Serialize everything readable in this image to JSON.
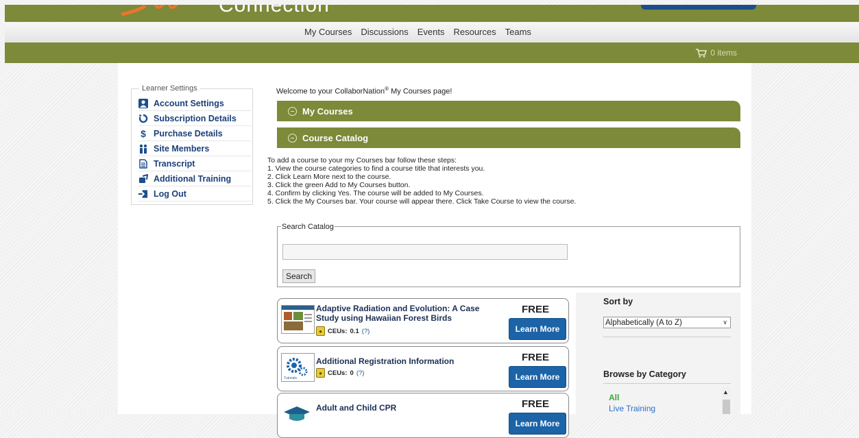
{
  "header": {
    "logo_text": "Connection"
  },
  "nav": {
    "items": [
      "My Courses",
      "Discussions",
      "Events",
      "Resources",
      "Teams"
    ]
  },
  "cart": {
    "label": "0 items"
  },
  "settings": {
    "legend": "Learner Settings",
    "items": [
      {
        "label": "Account Settings",
        "icon": "user-icon"
      },
      {
        "label": "Subscription Details",
        "icon": "refresh-icon"
      },
      {
        "label": "Purchase Details",
        "icon": "dollar-icon"
      },
      {
        "label": "Site Members",
        "icon": "members-icon"
      },
      {
        "label": "Transcript",
        "icon": "document-icon"
      },
      {
        "label": "Additional Training",
        "icon": "training-icon"
      },
      {
        "label": "Log Out",
        "icon": "logout-icon"
      }
    ]
  },
  "main": {
    "welcome_prefix": "Welcome to your CollaborNation",
    "welcome_reg": "®",
    "welcome_suffix": " My Courses page!",
    "my_courses_bar": "My Courses",
    "catalog_bar": "Course Catalog",
    "steps": [
      "To add a course to your my Courses bar follow these steps:",
      "1. View the course categories to find a course title that interests you.",
      "2. Click Learn More next to the course.",
      "3. Click the green Add to My Courses button.",
      "4. Confirm by clicking Yes. The course will be added to My Courses.",
      "5. Click the My Courses bar. Your course will appear there. Click Take Course to view the course."
    ],
    "search_legend": "Search Catalog",
    "search_value": "",
    "search_button": "Search"
  },
  "courses": [
    {
      "title": "Adaptive Radiation and Evolution: A Case Study using Hawaiian Forest Birds",
      "ceus_label": "CEUs:",
      "ceus_value": "0.1",
      "help": "(?)",
      "price": "FREE",
      "button": "Learn More"
    },
    {
      "title": "Additional Registration Information",
      "ceus_label": "CEUs:",
      "ceus_value": "0",
      "help": "(?)",
      "price": "FREE",
      "button": "Learn More"
    },
    {
      "title": "Adult and Child CPR",
      "ceus_label": "CEUs:",
      "ceus_value": "",
      "help": "",
      "price": "FREE",
      "button": "Learn More"
    }
  ],
  "sidebar": {
    "sort_label": "Sort by",
    "sort_selected": "Alphabetically (A to Z)",
    "browse_label": "Browse by Category",
    "categories": [
      "All",
      "Live Training"
    ]
  },
  "colors": {
    "brand_green": "#7c8a39",
    "link_blue": "#1c3f7a",
    "button_blue": "#1c63a8"
  }
}
